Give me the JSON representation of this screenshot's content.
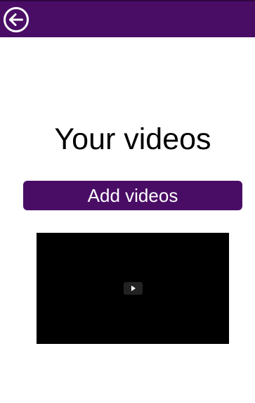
{
  "header": {
    "back_icon": "arrow-left-circle-icon",
    "accent_color": "#4a0d66"
  },
  "main": {
    "title": "Your videos",
    "add_button_label": "Add videos"
  },
  "video": {
    "play_icon": "play-icon"
  }
}
